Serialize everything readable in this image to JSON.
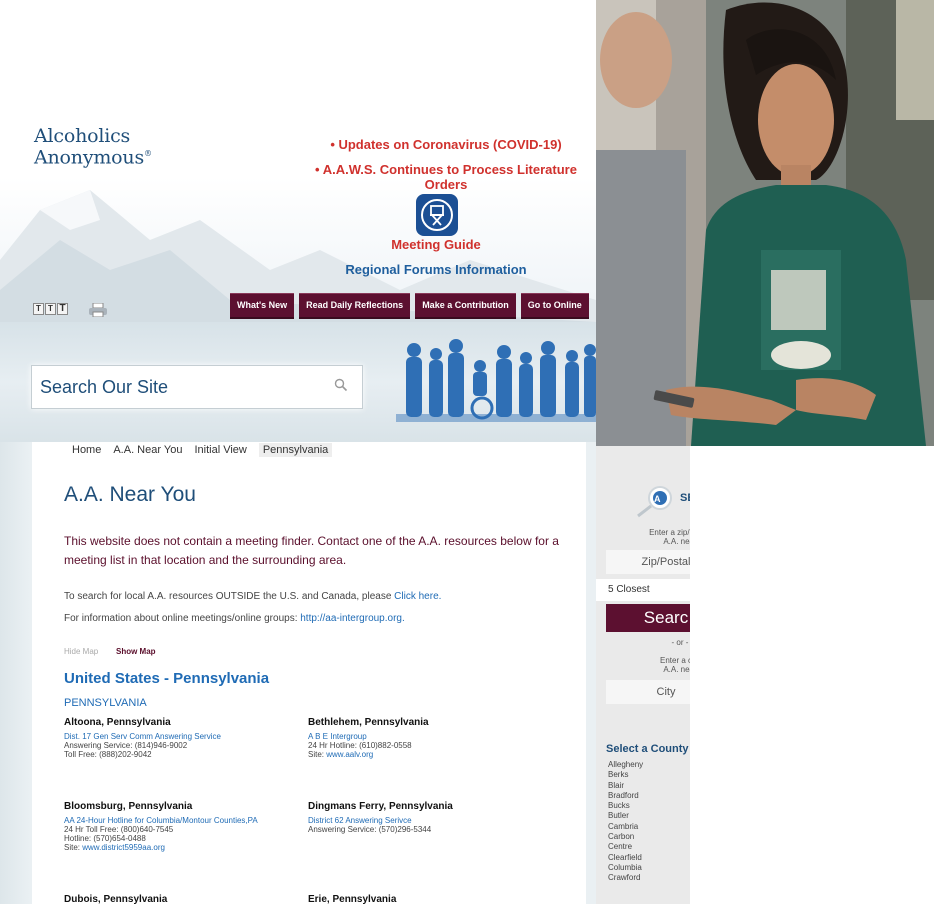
{
  "logo": {
    "line1": "Alcoholics",
    "line2": "Anonymous"
  },
  "announcements": [
    "• Updates on Coronavirus (COVID-19)",
    "• A.A.W.S. Continues to Process Literature Orders"
  ],
  "meeting_guide": "Meeting Guide",
  "regional_forums": "Regional Forums Information",
  "nav": [
    "What's New",
    "Read Daily Reflections",
    "Make a Contribution",
    "Go to Online"
  ],
  "search": {
    "placeholder": "Search Our Site"
  },
  "breadcrumb": [
    "Home",
    "A.A. Near You",
    "Initial View",
    "Pennsylvania"
  ],
  "page_title": "A.A. Near You",
  "notice": "This website does not contain a meeting finder. Contact one of the A.A. resources below for a meeting list in that location and the surrounding area.",
  "info1": {
    "text": "To search for local A.A. resources OUTSIDE the U.S. and Canada, please ",
    "link": "Click here."
  },
  "info2": {
    "text": "For information about online meetings/online groups: ",
    "link": "http://aa-intergroup.org."
  },
  "map_toggle": {
    "hide": "Hide Map",
    "show": "Show Map"
  },
  "region_title": "United States - Pennsylvania",
  "state_label": "PENNSYLVANIA",
  "entries": [
    {
      "city": "Altoona, Pennsylvania",
      "link": "Dist. 17 Gen Serv Comm Answering Service",
      "lines": [
        "Answering Service: (814)946-9002",
        "Toll Free: (888)202-9042"
      ]
    },
    {
      "city": "Bethlehem, Pennsylvania",
      "link": "A B E Intergroup",
      "lines": [
        "24 Hr Hotline: (610)882-0558"
      ],
      "site_prefix": "Site: ",
      "site": "www.aalv.org"
    },
    {
      "city": "Bloomsburg, Pennsylvania",
      "link": "AA 24-Hour Hotline for Columbia/Montour Counties,PA",
      "lines": [
        "24 Hr Toll Free: (800)640-7545",
        "Hotline: (570)654-0488"
      ],
      "site_prefix": "Site: ",
      "site": "www.district5959aa.org"
    },
    {
      "city": "Dingmans Ferry, Pennsylvania",
      "link": "District 62 Answering Serivce",
      "lines": [
        "Answering Service: (570)296-5344"
      ]
    },
    {
      "city": "Dubois, Pennsylvania"
    },
    {
      "city": "Erie, Pennsylvania"
    }
  ],
  "finder": {
    "heading": "SE",
    "enter_zip": "Enter a zip/postal",
    "enter_zip2": "A.A. near",
    "zip_placeholder": "Zip/Postal",
    "closest": "5 Closest",
    "search_button": "Searc",
    "or": "- or -",
    "enter_city": "Enter a city",
    "enter_city2": "A.A. near",
    "city_placeholder": "City"
  },
  "county_heading": "Select a County",
  "counties": [
    "Allegheny",
    "Berks",
    "Blair",
    "Bradford",
    "Bucks",
    "Butler",
    "Cambria",
    "Carbon",
    "Centre",
    "Clearfield",
    "Columbia",
    "Crawford"
  ],
  "colors": {
    "brand_blue": "#1f4e79",
    "link_blue": "#1f6bb5",
    "nav_maroon": "#5c1030",
    "alert_red": "#d0312d"
  }
}
